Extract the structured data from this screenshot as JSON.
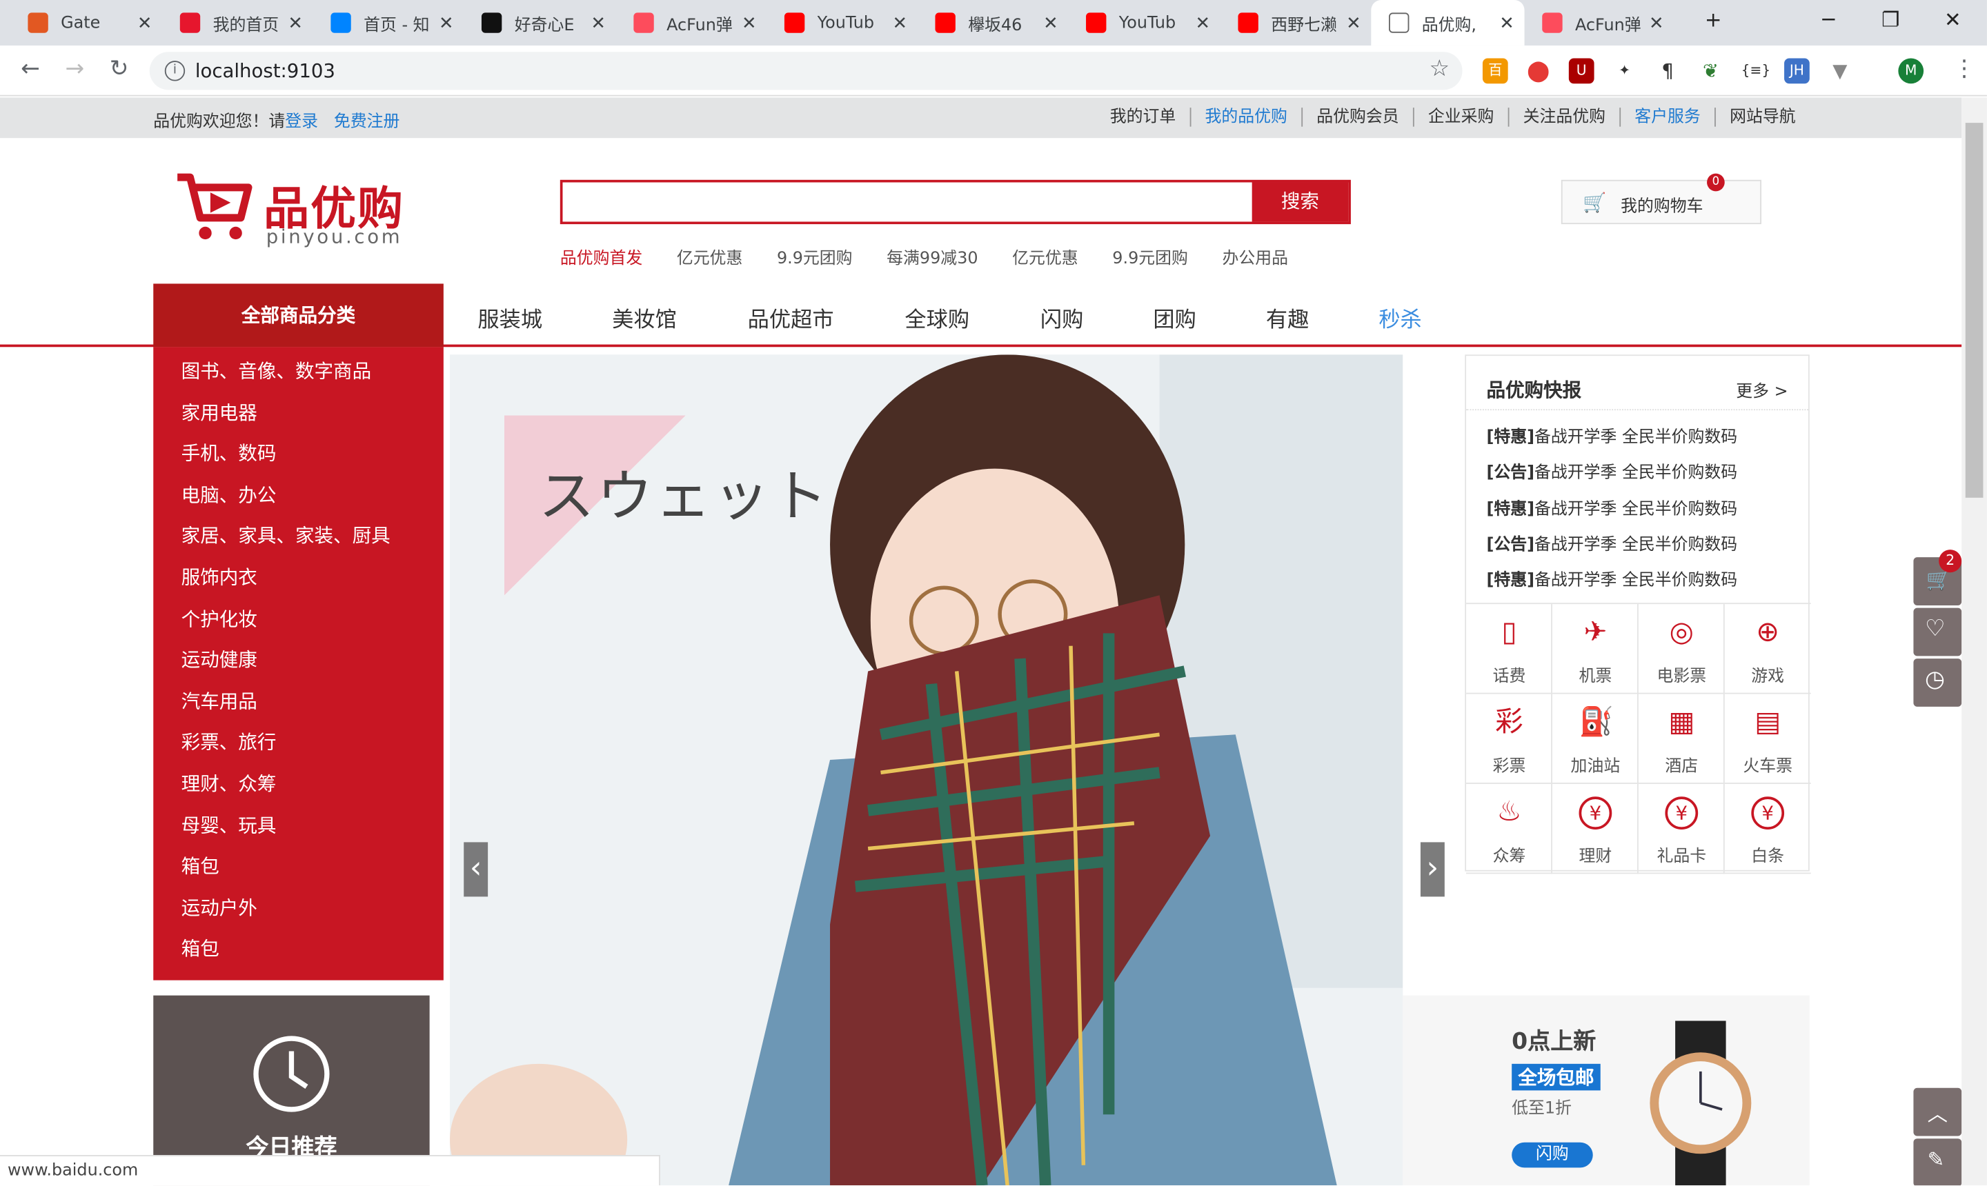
{
  "browser": {
    "tabs": [
      {
        "title": "Gate",
        "favicon_color": "#e25822"
      },
      {
        "title": "我的首页",
        "favicon_color": "#e6162d"
      },
      {
        "title": "首页 - 知",
        "favicon_color": "#0084ff"
      },
      {
        "title": "好奇心E",
        "favicon_color": "#111111"
      },
      {
        "title": "AcFun弹",
        "favicon_color": "#fd4c5c"
      },
      {
        "title": "YouTub",
        "favicon_color": "#ff0000"
      },
      {
        "title": "欅坂46",
        "favicon_color": "#ff0000"
      },
      {
        "title": "YouTub",
        "favicon_color": "#ff0000"
      },
      {
        "title": "西野七濑",
        "favicon_color": "#ff0000"
      },
      {
        "title": "品优购,",
        "favicon_color": "#ffffff"
      },
      {
        "title": "AcFun弹",
        "favicon_color": "#fd4c5c"
      }
    ],
    "active_tab_index": 9,
    "new_tab": "+",
    "window_controls": {
      "minimize": "─",
      "restore": "❐",
      "close": "✕"
    },
    "url": "localhost:9103",
    "profile_initial": "M",
    "status_url": "www.baidu.com"
  },
  "site": {
    "welcome": "品优购欢迎您！请",
    "login": "登录",
    "register": "免费注册",
    "top_links": [
      "我的订单",
      "我的品优购",
      "品优购会员",
      "企业采购",
      "关注品优购",
      "客户服务",
      "网站导航"
    ],
    "logo_cn": "品优购",
    "logo_en": "pinyou.com",
    "search_button": "搜索",
    "search_value": "",
    "hot_words": [
      "品优购首发",
      "亿元优惠",
      "9.9元团购",
      "每满99减30",
      "亿元优惠",
      "9.9元团购",
      "办公用品"
    ],
    "cart_label": "我的购物车",
    "cart_count": "0",
    "all_categories": "全部商品分类",
    "nav": [
      "服装城",
      "美妆馆",
      "品优超市",
      "全球购",
      "闪购",
      "团购",
      "有趣",
      "秒杀"
    ],
    "categories": [
      "图书、音像、数字商品",
      "家用电器",
      "手机、数码",
      "电脑、办公",
      "家居、家具、家装、厨具",
      "服饰内衣",
      "个护化妆",
      "运动健康",
      "汽车用品",
      "彩票、旅行",
      "理财、众筹",
      "母婴、玩具",
      "箱包",
      "运动户外",
      "箱包"
    ],
    "banner_text": "スウェット",
    "prev_arrow": "‹",
    "next_arrow": "›",
    "news": {
      "title": "品优购快报",
      "more": "更多 >",
      "items": [
        {
          "tag": "[特惠]",
          "text": "备战开学季 全民半价购数码"
        },
        {
          "tag": "[公告]",
          "text": "备战开学季 全民半价购数码"
        },
        {
          "tag": "[特惠]",
          "text": "备战开学季 全民半价购数码"
        },
        {
          "tag": "[公告]",
          "text": "备战开学季 全民半价购数码"
        },
        {
          "tag": "[特惠]",
          "text": "备战开学季 全民半价购数码"
        }
      ]
    },
    "services": [
      {
        "label": "话费",
        "icon": "phone-icon"
      },
      {
        "label": "机票",
        "icon": "plane-icon"
      },
      {
        "label": "电影票",
        "icon": "film-icon"
      },
      {
        "label": "游戏",
        "icon": "gamepad-icon"
      },
      {
        "label": "彩票",
        "icon": "lottery-icon"
      },
      {
        "label": "加油站",
        "icon": "gas-station-icon"
      },
      {
        "label": "酒店",
        "icon": "hotel-icon"
      },
      {
        "label": "火车票",
        "icon": "train-icon"
      },
      {
        "label": "众筹",
        "icon": "crowdfund-icon"
      },
      {
        "label": "理财",
        "icon": "yuan-icon"
      },
      {
        "label": "礼品卡",
        "icon": "yuan-icon"
      },
      {
        "label": "白条",
        "icon": "yuan-icon"
      }
    ],
    "today_recommend": "今日推荐",
    "promo": {
      "title": "0点上新",
      "badge": "全场包邮",
      "sub": "低至1折",
      "button": "闪购"
    },
    "sidebar_cart_count": "2",
    "accent": "#c81623"
  }
}
